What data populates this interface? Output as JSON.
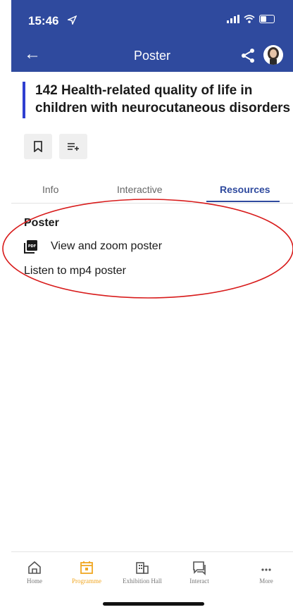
{
  "status_bar": {
    "time": "15:46"
  },
  "header": {
    "title": "Poster"
  },
  "poster": {
    "title_line1": "142 Health-related quality of life in",
    "title_line2": "children with neurocutaneous disorders"
  },
  "tabs": [
    {
      "label": "Info",
      "active": false
    },
    {
      "label": "Interactive",
      "active": false
    },
    {
      "label": "Resources",
      "active": true
    }
  ],
  "resources": {
    "section_title": "Poster",
    "items": [
      {
        "label": "View and zoom poster",
        "icon": "pdf-icon"
      },
      {
        "label": "Listen to mp4 poster"
      }
    ]
  },
  "bottom_nav": [
    {
      "label": "Home",
      "icon": "home-icon",
      "active": false
    },
    {
      "label": "Programme",
      "icon": "calendar-icon",
      "active": true
    },
    {
      "label": "Exhibition Hall",
      "icon": "building-icon",
      "active": false
    },
    {
      "label": "Interact",
      "icon": "chat-icon",
      "active": false
    },
    {
      "label": "More",
      "icon": "more-icon",
      "active": false
    }
  ],
  "colors": {
    "header_bg": "#2f4a9e",
    "title_accent": "#2f3fd0",
    "active_nav": "#f1a723",
    "annotation": "#d81b1b"
  }
}
